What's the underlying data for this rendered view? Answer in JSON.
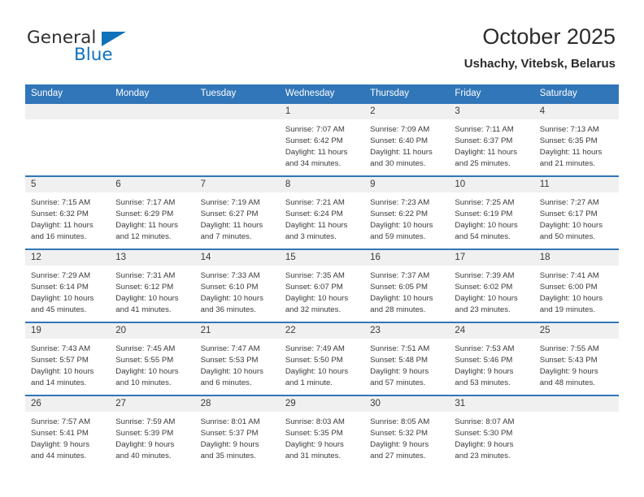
{
  "brand": {
    "name_part1": "General",
    "name_part2": "Blue",
    "accent_color": "#1071bb"
  },
  "header": {
    "title": "October 2025",
    "subtitle": "Ushachy, Vitebsk, Belarus",
    "header_bg_color": "#3176b8",
    "daynum_bg_color": "#f0f0f0"
  },
  "weekday_headers": [
    "Sunday",
    "Monday",
    "Tuesday",
    "Wednesday",
    "Thursday",
    "Friday",
    "Saturday"
  ],
  "weeks": [
    [
      {
        "day": "",
        "sunrise": "",
        "sunset": "",
        "daylight_line1": "",
        "daylight_line2": ""
      },
      {
        "day": "",
        "sunrise": "",
        "sunset": "",
        "daylight_line1": "",
        "daylight_line2": ""
      },
      {
        "day": "",
        "sunrise": "",
        "sunset": "",
        "daylight_line1": "",
        "daylight_line2": ""
      },
      {
        "day": "1",
        "sunrise": "Sunrise: 7:07 AM",
        "sunset": "Sunset: 6:42 PM",
        "daylight_line1": "Daylight: 11 hours",
        "daylight_line2": "and 34 minutes."
      },
      {
        "day": "2",
        "sunrise": "Sunrise: 7:09 AM",
        "sunset": "Sunset: 6:40 PM",
        "daylight_line1": "Daylight: 11 hours",
        "daylight_line2": "and 30 minutes."
      },
      {
        "day": "3",
        "sunrise": "Sunrise: 7:11 AM",
        "sunset": "Sunset: 6:37 PM",
        "daylight_line1": "Daylight: 11 hours",
        "daylight_line2": "and 25 minutes."
      },
      {
        "day": "4",
        "sunrise": "Sunrise: 7:13 AM",
        "sunset": "Sunset: 6:35 PM",
        "daylight_line1": "Daylight: 11 hours",
        "daylight_line2": "and 21 minutes."
      }
    ],
    [
      {
        "day": "5",
        "sunrise": "Sunrise: 7:15 AM",
        "sunset": "Sunset: 6:32 PM",
        "daylight_line1": "Daylight: 11 hours",
        "daylight_line2": "and 16 minutes."
      },
      {
        "day": "6",
        "sunrise": "Sunrise: 7:17 AM",
        "sunset": "Sunset: 6:29 PM",
        "daylight_line1": "Daylight: 11 hours",
        "daylight_line2": "and 12 minutes."
      },
      {
        "day": "7",
        "sunrise": "Sunrise: 7:19 AM",
        "sunset": "Sunset: 6:27 PM",
        "daylight_line1": "Daylight: 11 hours",
        "daylight_line2": "and 7 minutes."
      },
      {
        "day": "8",
        "sunrise": "Sunrise: 7:21 AM",
        "sunset": "Sunset: 6:24 PM",
        "daylight_line1": "Daylight: 11 hours",
        "daylight_line2": "and 3 minutes."
      },
      {
        "day": "9",
        "sunrise": "Sunrise: 7:23 AM",
        "sunset": "Sunset: 6:22 PM",
        "daylight_line1": "Daylight: 10 hours",
        "daylight_line2": "and 59 minutes."
      },
      {
        "day": "10",
        "sunrise": "Sunrise: 7:25 AM",
        "sunset": "Sunset: 6:19 PM",
        "daylight_line1": "Daylight: 10 hours",
        "daylight_line2": "and 54 minutes."
      },
      {
        "day": "11",
        "sunrise": "Sunrise: 7:27 AM",
        "sunset": "Sunset: 6:17 PM",
        "daylight_line1": "Daylight: 10 hours",
        "daylight_line2": "and 50 minutes."
      }
    ],
    [
      {
        "day": "12",
        "sunrise": "Sunrise: 7:29 AM",
        "sunset": "Sunset: 6:14 PM",
        "daylight_line1": "Daylight: 10 hours",
        "daylight_line2": "and 45 minutes."
      },
      {
        "day": "13",
        "sunrise": "Sunrise: 7:31 AM",
        "sunset": "Sunset: 6:12 PM",
        "daylight_line1": "Daylight: 10 hours",
        "daylight_line2": "and 41 minutes."
      },
      {
        "day": "14",
        "sunrise": "Sunrise: 7:33 AM",
        "sunset": "Sunset: 6:10 PM",
        "daylight_line1": "Daylight: 10 hours",
        "daylight_line2": "and 36 minutes."
      },
      {
        "day": "15",
        "sunrise": "Sunrise: 7:35 AM",
        "sunset": "Sunset: 6:07 PM",
        "daylight_line1": "Daylight: 10 hours",
        "daylight_line2": "and 32 minutes."
      },
      {
        "day": "16",
        "sunrise": "Sunrise: 7:37 AM",
        "sunset": "Sunset: 6:05 PM",
        "daylight_line1": "Daylight: 10 hours",
        "daylight_line2": "and 28 minutes."
      },
      {
        "day": "17",
        "sunrise": "Sunrise: 7:39 AM",
        "sunset": "Sunset: 6:02 PM",
        "daylight_line1": "Daylight: 10 hours",
        "daylight_line2": "and 23 minutes."
      },
      {
        "day": "18",
        "sunrise": "Sunrise: 7:41 AM",
        "sunset": "Sunset: 6:00 PM",
        "daylight_line1": "Daylight: 10 hours",
        "daylight_line2": "and 19 minutes."
      }
    ],
    [
      {
        "day": "19",
        "sunrise": "Sunrise: 7:43 AM",
        "sunset": "Sunset: 5:57 PM",
        "daylight_line1": "Daylight: 10 hours",
        "daylight_line2": "and 14 minutes."
      },
      {
        "day": "20",
        "sunrise": "Sunrise: 7:45 AM",
        "sunset": "Sunset: 5:55 PM",
        "daylight_line1": "Daylight: 10 hours",
        "daylight_line2": "and 10 minutes."
      },
      {
        "day": "21",
        "sunrise": "Sunrise: 7:47 AM",
        "sunset": "Sunset: 5:53 PM",
        "daylight_line1": "Daylight: 10 hours",
        "daylight_line2": "and 6 minutes."
      },
      {
        "day": "22",
        "sunrise": "Sunrise: 7:49 AM",
        "sunset": "Sunset: 5:50 PM",
        "daylight_line1": "Daylight: 10 hours",
        "daylight_line2": "and 1 minute."
      },
      {
        "day": "23",
        "sunrise": "Sunrise: 7:51 AM",
        "sunset": "Sunset: 5:48 PM",
        "daylight_line1": "Daylight: 9 hours",
        "daylight_line2": "and 57 minutes."
      },
      {
        "day": "24",
        "sunrise": "Sunrise: 7:53 AM",
        "sunset": "Sunset: 5:46 PM",
        "daylight_line1": "Daylight: 9 hours",
        "daylight_line2": "and 53 minutes."
      },
      {
        "day": "25",
        "sunrise": "Sunrise: 7:55 AM",
        "sunset": "Sunset: 5:43 PM",
        "daylight_line1": "Daylight: 9 hours",
        "daylight_line2": "and 48 minutes."
      }
    ],
    [
      {
        "day": "26",
        "sunrise": "Sunrise: 7:57 AM",
        "sunset": "Sunset: 5:41 PM",
        "daylight_line1": "Daylight: 9 hours",
        "daylight_line2": "and 44 minutes."
      },
      {
        "day": "27",
        "sunrise": "Sunrise: 7:59 AM",
        "sunset": "Sunset: 5:39 PM",
        "daylight_line1": "Daylight: 9 hours",
        "daylight_line2": "and 40 minutes."
      },
      {
        "day": "28",
        "sunrise": "Sunrise: 8:01 AM",
        "sunset": "Sunset: 5:37 PM",
        "daylight_line1": "Daylight: 9 hours",
        "daylight_line2": "and 35 minutes."
      },
      {
        "day": "29",
        "sunrise": "Sunrise: 8:03 AM",
        "sunset": "Sunset: 5:35 PM",
        "daylight_line1": "Daylight: 9 hours",
        "daylight_line2": "and 31 minutes."
      },
      {
        "day": "30",
        "sunrise": "Sunrise: 8:05 AM",
        "sunset": "Sunset: 5:32 PM",
        "daylight_line1": "Daylight: 9 hours",
        "daylight_line2": "and 27 minutes."
      },
      {
        "day": "31",
        "sunrise": "Sunrise: 8:07 AM",
        "sunset": "Sunset: 5:30 PM",
        "daylight_line1": "Daylight: 9 hours",
        "daylight_line2": "and 23 minutes."
      },
      {
        "day": "",
        "sunrise": "",
        "sunset": "",
        "daylight_line1": "",
        "daylight_line2": ""
      }
    ]
  ]
}
